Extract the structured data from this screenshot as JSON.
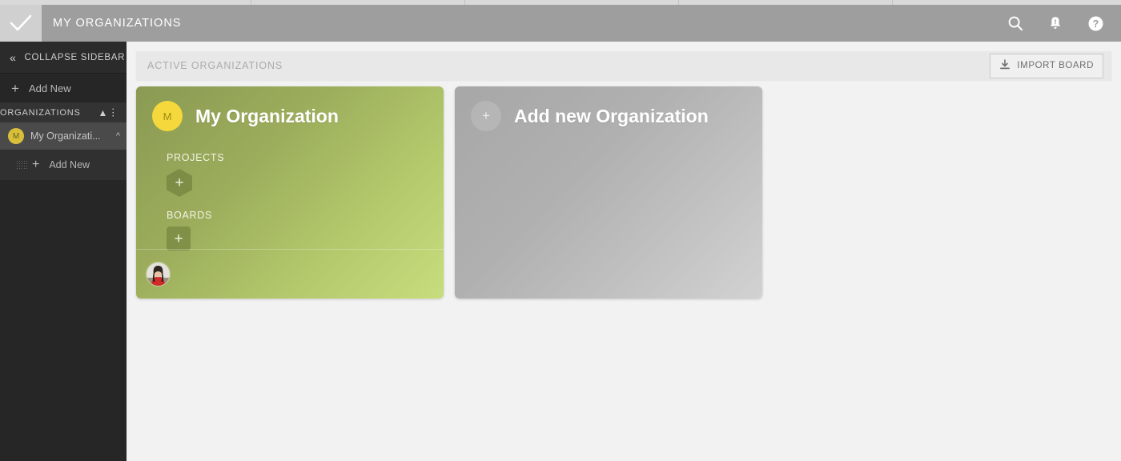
{
  "topbar": {
    "logo_icon": "checkmark-logo-icon",
    "title": "MY ORGANIZATIONS",
    "icons": [
      {
        "name": "search-icon",
        "label": "Search"
      },
      {
        "name": "notifications-bell-icon",
        "label": "Notifications"
      },
      {
        "name": "help-icon",
        "label": "Help"
      }
    ],
    "bg_color": "#9e9e9e"
  },
  "sidebar": {
    "collapse_label": "COLLAPSE SIDEBAR",
    "collapse_icon": "chevron-double-left-icon",
    "add_new_label": "Add New",
    "add_new_icon": "plus-icon",
    "section": {
      "label": "ORGANIZATIONS",
      "collapse_icon": "chevron-double-up-icon"
    },
    "organization": {
      "avatar_initial": "M",
      "avatar_color": "#d8bf3a",
      "name": "My Organizati...",
      "chevron_icon": "chevron-up-icon"
    },
    "sub_add_new_label": "Add New",
    "sub_add_new_icon": "plus-icon",
    "drag_handle_icon": "drag-dots-icon",
    "bg_color": "#262626"
  },
  "content": {
    "header": {
      "title": "ACTIVE ORGANIZATIONS",
      "import_button": {
        "label": "IMPORT BOARD",
        "icon": "download-icon"
      }
    },
    "cards": [
      {
        "type": "organization",
        "avatar_initial": "M",
        "avatar_color": "#f5d93c",
        "title": "My Organization",
        "groups": [
          {
            "label": "PROJECTS",
            "add_icon": "plus-icon",
            "add_shape": "hexagon"
          },
          {
            "label": "BOARDS",
            "add_icon": "plus-icon",
            "add_shape": "rounded-square"
          }
        ],
        "members": [
          {
            "name": "member-avatar",
            "icon": "user-photo-avatar"
          }
        ],
        "gradient_from": "#8a9a53",
        "gradient_to": "#c8dd7d"
      },
      {
        "type": "add-new",
        "avatar_icon": "plus-icon",
        "title": "Add new Organization",
        "gradient_from": "#a7a7a7",
        "gradient_to": "#d2d2d2"
      }
    ]
  }
}
